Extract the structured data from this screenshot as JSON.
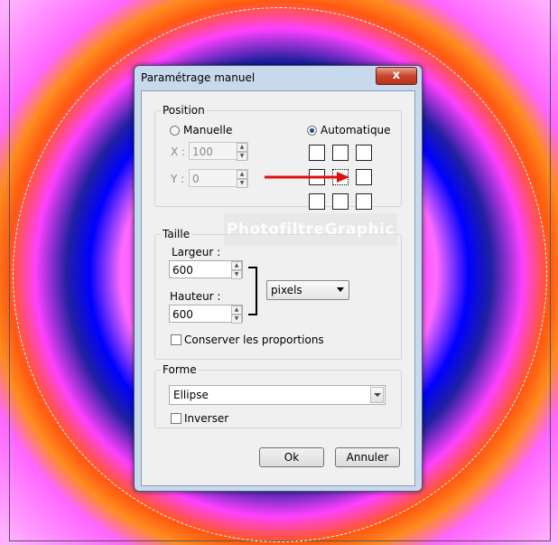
{
  "dialog": {
    "title": "Paramétrage manuel",
    "close_label": "x",
    "position": {
      "legend": "Position",
      "manual_label": "Manuelle",
      "automatic_label": "Automatique",
      "x_label": "X :",
      "x_value": "100",
      "y_label": "Y :",
      "y_value": "0",
      "selected_mode": "Automatique",
      "anchor_selected": "center"
    },
    "size": {
      "legend": "Taille",
      "width_label": "Largeur :",
      "width_value": "600",
      "height_label": "Hauteur :",
      "height_value": "600",
      "unit": "pixels",
      "keep_proportions_label": "Conserver les proportions",
      "keep_proportions": false
    },
    "shape": {
      "legend": "Forme",
      "value": "Ellipse",
      "invert_label": "Inverser",
      "invert": false
    },
    "ok_label": "Ok",
    "cancel_label": "Annuler"
  },
  "watermark": "PhotofiltreGraphic",
  "colors": {
    "arrow": "#e01010",
    "close_button": "#c7452c",
    "dialog_frame": "#c7d9ec"
  }
}
